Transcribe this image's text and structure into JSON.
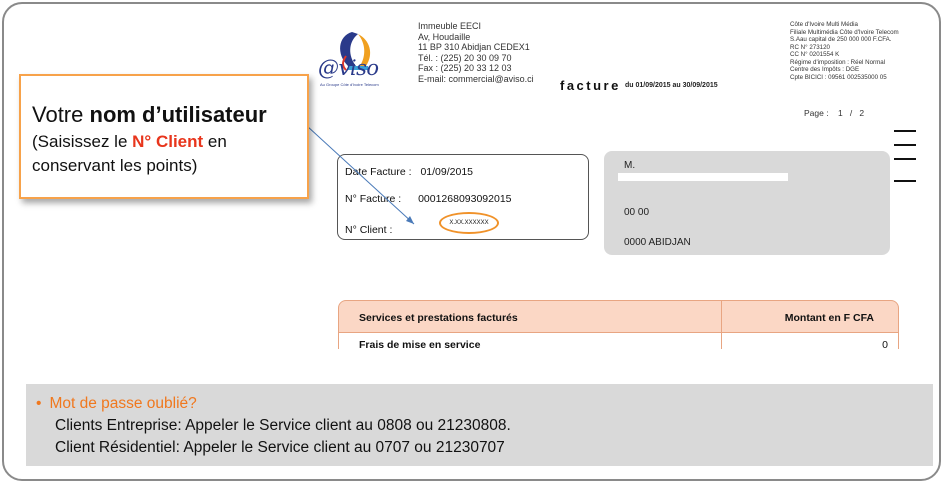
{
  "invoice": {
    "logo": {
      "word": "@viso",
      "tagline": "Au Groupe Côte d'Ivoire Telecom"
    },
    "address_lines": [
      "Immeuble EECI",
      "Av, Houdaille",
      "11 BP 310 Abidjan CEDEX1",
      "Tél. : (225) 20 30 09 70",
      "Fax : (225) 20 33 12 03",
      "E-mail: commercial@aviso.ci"
    ],
    "title": "facture",
    "period": "du 01/09/2015  au 30/09/2015",
    "company_lines": [
      "Côte d'Ivoire Multi Média",
      "Filiale Multimédia Côte d'Ivoire Telecom",
      "S.Aau capital de 250 000 000 F.CFA.",
      "RC N° 273120",
      "CC N° 0201554 K",
      "Régime d'imposition : Réel Normal",
      "Centre des Impôts : DGE",
      "Cpte BICICI : 09561 002535000 05"
    ],
    "page": {
      "label": "Page :",
      "current": "1",
      "sep": "/",
      "total": "2"
    },
    "info": {
      "date_label": "Date Facture :",
      "date_value": "01/09/2015",
      "number_label": "N° Facture :",
      "number_value": "0001268093092015",
      "client_label": "N° Client :",
      "client_value": "X.XX.XXXXXX"
    },
    "recipient": {
      "title": "M.",
      "line2": "00 00",
      "line3": "0000 ABIDJAN"
    },
    "table": {
      "col_services": "Services et prestations facturés",
      "col_amount": "Montant en F CFA",
      "rows": [
        {
          "label": "Frais de mise en service",
          "amount": "0"
        }
      ]
    }
  },
  "callout": {
    "title_prefix": "Votre",
    "title_bold": "nom d’utilisateur",
    "sub_prefix": "(Saisissez le",
    "sub_highlight": "N° Client",
    "sub_suffix": "en",
    "sub_line2": "conservant les points)"
  },
  "help": {
    "forgot": "Mot de passe oublié?",
    "enterprise": "Clients Entreprise: Appeler le Service client au 0808 ou 21230808.",
    "residential": "Client Résidentiel:  Appeler le Service client au 0707 ou 21230707"
  },
  "colors": {
    "accent_orange": "#f7a24a",
    "highlight_red": "#e8351c",
    "table_header": "#fbd7c5",
    "gray_box": "#d9d9d9"
  }
}
